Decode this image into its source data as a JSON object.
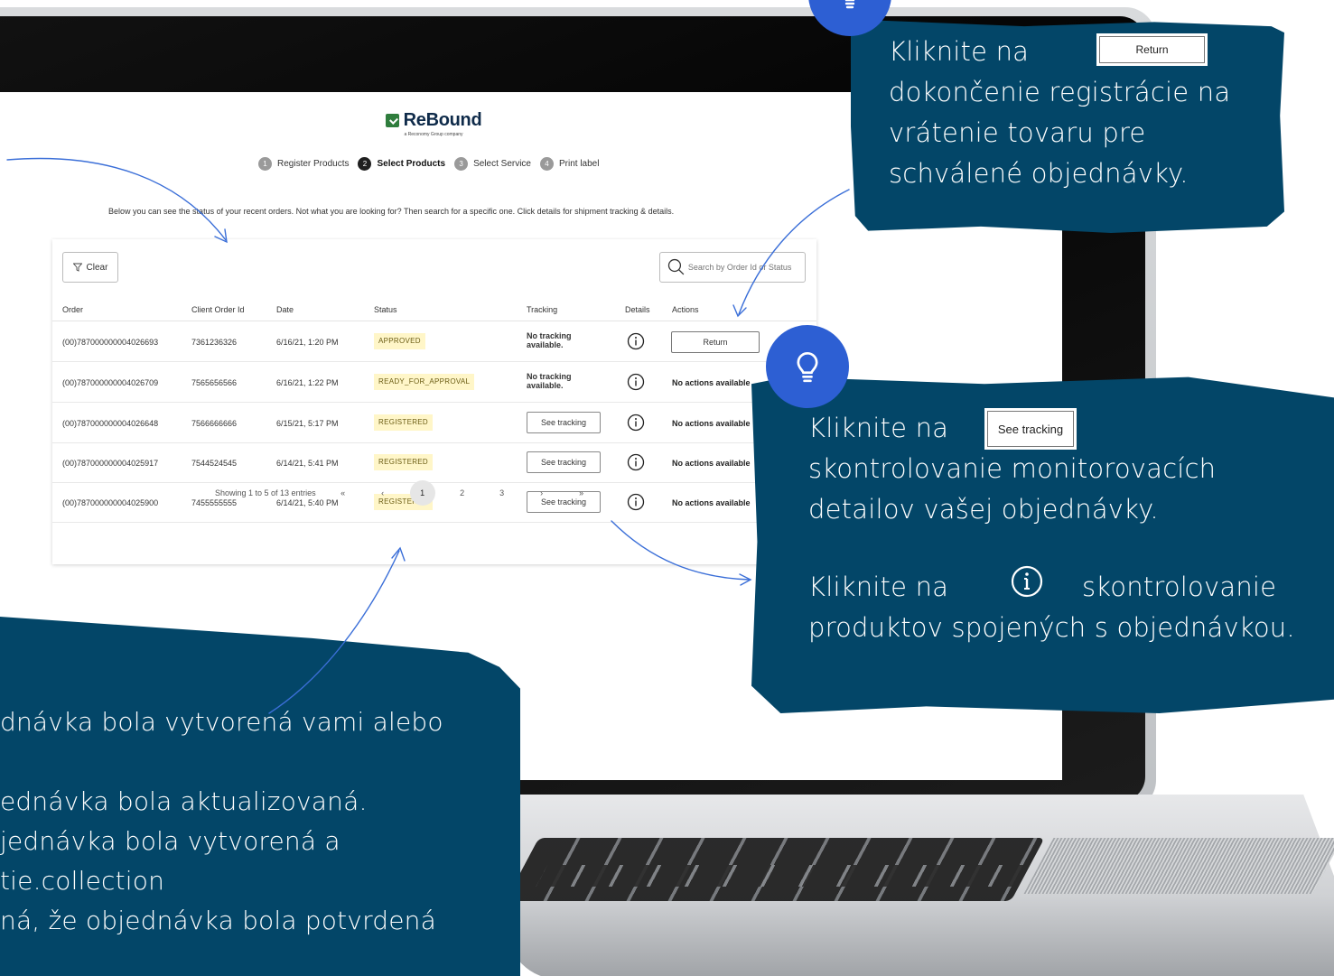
{
  "app": {
    "brand": "ReBound",
    "brand_sub": "a Reconomy Group company",
    "steps": [
      {
        "num": "1",
        "label": "Register Products",
        "active": false
      },
      {
        "num": "2",
        "label": "Select Products",
        "active": true
      },
      {
        "num": "3",
        "label": "Select Service",
        "active": false
      },
      {
        "num": "4",
        "label": "Print label",
        "active": false
      }
    ],
    "intro": "Below you can see the status of your recent orders. Not what you are looking for? Then search for a specific one. Click details for shipment tracking & details.",
    "clear_label": "Clear",
    "search_placeholder": "Search by Order Id or Status",
    "columns": [
      "Order",
      "Client Order Id",
      "Date",
      "Status",
      "Tracking",
      "Details",
      "Actions"
    ],
    "rows": [
      {
        "order": "(00)787000000004026693",
        "client": "7361236326",
        "date": "6/16/21, 1:20 PM",
        "status": "APPROVED",
        "tracking": "No tracking available.",
        "action": "Return"
      },
      {
        "order": "(00)787000000004026709",
        "client": "7565656566",
        "date": "6/16/21, 1:22 PM",
        "status": "READY_FOR_APPROVAL",
        "tracking": "No tracking available.",
        "action": "No actions available"
      },
      {
        "order": "(00)787000000004026648",
        "client": "7566666666",
        "date": "6/15/21, 5:17 PM",
        "status": "REGISTERED",
        "tracking": "See tracking",
        "action": "No actions available"
      },
      {
        "order": "(00)787000000004025917",
        "client": "7544524545",
        "date": "6/14/21, 5:41 PM",
        "status": "REGISTERED",
        "tracking": "See tracking",
        "action": "No actions available"
      },
      {
        "order": "(00)787000000004025900",
        "client": "7455555555",
        "date": "6/14/21, 5:40 PM",
        "status": "REGISTERED",
        "tracking": "See tracking",
        "action": "No actions available"
      }
    ],
    "pagination": {
      "summary": "Showing 1 to 5 of 13 entries",
      "first": "«",
      "prev": "‹",
      "pages": [
        "1",
        "2",
        "3"
      ],
      "current": "1",
      "next": "›",
      "last": "»"
    }
  },
  "callouts": {
    "top": {
      "line1": "Kliknite na",
      "button": "Return",
      "rest": "dokončenie registrácie na vrátenie tovaru pre schválené objednávky."
    },
    "right": {
      "line1": "Kliknite na",
      "button": "See tracking",
      "rest": "skontrolovanie monitorovacích detailov vašej objednávky.",
      "line3a": "Kliknite na",
      "line3b": "skontrolovanie",
      "rest2": "produktov spojených s objednávkou."
    },
    "bottom": {
      "lines": [
        "dnávka bola vytvorená vami alebo",
        "",
        "ednávka bola aktualizovaná.",
        "jednávka bola vytvorená a",
        "tie.collection",
        "ná, že objednávka bola potvrdená"
      ]
    }
  },
  "colors": {
    "callout_bg": "#034668",
    "bulb_bg": "#2d5fd3",
    "arrow": "#3b6fd8",
    "badge_bg": "#fff6c8"
  }
}
